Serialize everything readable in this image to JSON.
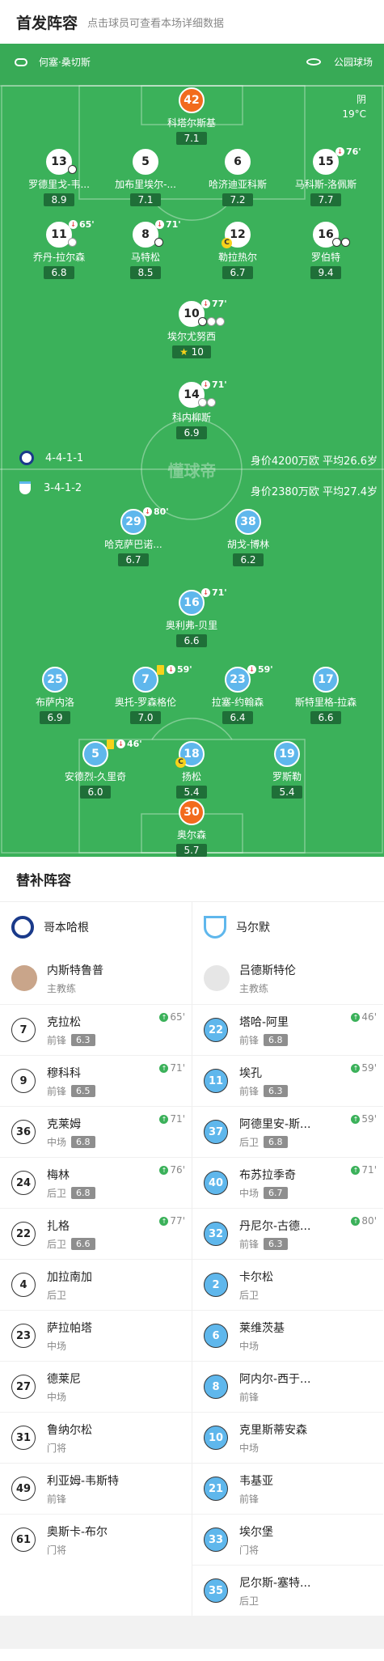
{
  "header": {
    "title": "首发阵容",
    "subtitle": "点击球员可查看本场详细数据"
  },
  "match": {
    "referee": "何塞·桑切斯",
    "stadium": "公园球场",
    "weather": "阴",
    "temperature": "19°C"
  },
  "home": {
    "formation": "4-4-1-1",
    "market_value": "身价4200万欧",
    "avg_age": "平均26.6岁",
    "players": [
      {
        "num": "42",
        "name": "科塔尔斯基",
        "rating": "7.1"
      },
      {
        "num": "13",
        "name": "罗德里戈-韦...",
        "rating": "8.9"
      },
      {
        "num": "5",
        "name": "加布里埃尔-...",
        "rating": "7.1"
      },
      {
        "num": "6",
        "name": "哈济迪亚科斯",
        "rating": "7.2"
      },
      {
        "num": "15",
        "name": "马科斯-洛佩斯",
        "rating": "7.7",
        "sub": "76'"
      },
      {
        "num": "11",
        "name": "乔丹-拉尔森",
        "rating": "6.8",
        "sub": "65'"
      },
      {
        "num": "8",
        "name": "马特松",
        "rating": "8.5",
        "sub": "71'"
      },
      {
        "num": "12",
        "name": "勒拉热尔",
        "rating": "6.7"
      },
      {
        "num": "16",
        "name": "罗伯特",
        "rating": "9.4"
      },
      {
        "num": "10",
        "name": "埃尔尤努西",
        "rating": "10",
        "sub": "77'"
      },
      {
        "num": "14",
        "name": "科内柳斯",
        "rating": "6.9",
        "sub": "71'"
      }
    ]
  },
  "away": {
    "formation": "3-4-1-2",
    "market_value": "身价2380万欧",
    "avg_age": "平均27.4岁",
    "players": [
      {
        "num": "29",
        "name": "哈克萨巴诺...",
        "rating": "6.7",
        "sub": "80'"
      },
      {
        "num": "38",
        "name": "胡戈-博林",
        "rating": "6.2"
      },
      {
        "num": "16",
        "name": "奥利弗-贝里",
        "rating": "6.6",
        "sub": "71'"
      },
      {
        "num": "25",
        "name": "布萨内洛",
        "rating": "6.9"
      },
      {
        "num": "7",
        "name": "奥托-罗森格伦",
        "rating": "7.0",
        "sub": "59'"
      },
      {
        "num": "23",
        "name": "拉塞-约翰森",
        "rating": "6.4",
        "sub": "59'"
      },
      {
        "num": "17",
        "name": "斯特里格-拉森",
        "rating": "6.6"
      },
      {
        "num": "5",
        "name": "安德烈-久里奇",
        "rating": "6.0",
        "sub": "46'"
      },
      {
        "num": "18",
        "name": "扬松",
        "rating": "5.4"
      },
      {
        "num": "19",
        "name": "罗斯勒",
        "rating": "5.4"
      },
      {
        "num": "30",
        "name": "奥尔森",
        "rating": "5.7"
      }
    ]
  },
  "watermark": "懂球帝",
  "subs": {
    "title": "替补阵容",
    "home": {
      "team": "哥本哈根",
      "coach": "内斯特鲁普",
      "coach_role": "主教练",
      "list": [
        {
          "num": "7",
          "name": "克拉松",
          "pos": "前锋",
          "rating": "6.3",
          "time": "65'"
        },
        {
          "num": "9",
          "name": "穆科科",
          "pos": "前锋",
          "rating": "6.5",
          "time": "71'"
        },
        {
          "num": "36",
          "name": "克莱姆",
          "pos": "中场",
          "rating": "6.8",
          "time": "71'"
        },
        {
          "num": "24",
          "name": "梅林",
          "pos": "后卫",
          "rating": "6.8",
          "time": "76'"
        },
        {
          "num": "22",
          "name": "扎格",
          "pos": "后卫",
          "rating": "6.6",
          "time": "77'"
        },
        {
          "num": "4",
          "name": "加拉南加",
          "pos": "后卫"
        },
        {
          "num": "23",
          "name": "萨拉帕塔",
          "pos": "中场"
        },
        {
          "num": "27",
          "name": "德莱尼",
          "pos": "中场"
        },
        {
          "num": "31",
          "name": "鲁纳尔松",
          "pos": "门将"
        },
        {
          "num": "49",
          "name": "利亚姆-韦斯特",
          "pos": "前锋"
        },
        {
          "num": "61",
          "name": "奥斯卡-布尔",
          "pos": "门将"
        }
      ]
    },
    "away": {
      "team": "马尔默",
      "coach": "吕德斯特伦",
      "coach_role": "主教练",
      "list": [
        {
          "num": "22",
          "name": "塔哈-阿里",
          "pos": "前锋",
          "rating": "6.8",
          "time": "46'"
        },
        {
          "num": "11",
          "name": "埃孔",
          "pos": "前锋",
          "rating": "6.3",
          "time": "59'"
        },
        {
          "num": "37",
          "name": "阿德里安-斯...",
          "pos": "后卫",
          "rating": "6.8",
          "time": "59'"
        },
        {
          "num": "40",
          "name": "布苏拉季奇",
          "pos": "中场",
          "rating": "6.7",
          "time": "71'"
        },
        {
          "num": "32",
          "name": "丹尼尔-古德...",
          "pos": "前锋",
          "rating": "6.3",
          "time": "80'"
        },
        {
          "num": "2",
          "name": "卡尔松",
          "pos": "后卫"
        },
        {
          "num": "6",
          "name": "莱维茨基",
          "pos": "中场"
        },
        {
          "num": "8",
          "name": "阿内尔-西于...",
          "pos": "前锋"
        },
        {
          "num": "10",
          "name": "克里斯蒂安森",
          "pos": "中场"
        },
        {
          "num": "21",
          "name": "韦基亚",
          "pos": "前锋"
        },
        {
          "num": "33",
          "name": "埃尔堡",
          "pos": "门将"
        },
        {
          "num": "35",
          "name": "尼尔斯-塞特...",
          "pos": "后卫"
        }
      ]
    }
  },
  "colors": {
    "pitch": "#3bb15a",
    "home": "#ffffff",
    "away": "#5fb7ec",
    "keeper_home": "#f26b1d"
  }
}
